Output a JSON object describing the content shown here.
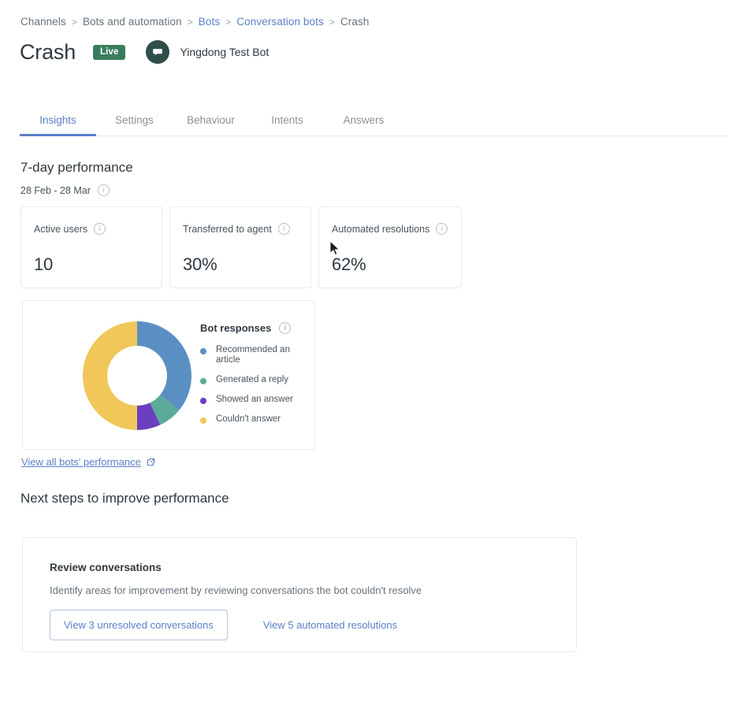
{
  "breadcrumb": {
    "items": [
      {
        "label": "Channels",
        "style": "plain"
      },
      {
        "label": "Bots and automation",
        "style": "plain"
      },
      {
        "label": "Bots",
        "style": "link"
      },
      {
        "label": "Conversation bots",
        "style": "link"
      },
      {
        "label": "Crash",
        "style": "plain"
      }
    ],
    "separator": ">"
  },
  "header": {
    "title": "Crash",
    "status_badge": "Live",
    "bot_name": "Yingdong Test Bot",
    "badge_color": "#3a7d5d",
    "avatar_color": "#2f4f4a"
  },
  "tabs": [
    {
      "label": "Insights",
      "active": true
    },
    {
      "label": "Settings",
      "active": false
    },
    {
      "label": "Behaviour",
      "active": false
    },
    {
      "label": "Intents",
      "active": false
    },
    {
      "label": "Answers",
      "active": false
    }
  ],
  "performance": {
    "title": "7-day performance",
    "date_range": "28 Feb - 28 Mar",
    "metrics": [
      {
        "label": "Active users",
        "value": "10"
      },
      {
        "label": "Transferred to agent",
        "value": "30%"
      },
      {
        "label": "Automated resolutions",
        "value": "62%"
      }
    ]
  },
  "chart_data": {
    "type": "pie",
    "title": "Bot responses",
    "categories": [
      "Recommended an article",
      "Generated a reply",
      "Showed an answer",
      "Couldn't answer"
    ],
    "values": [
      36,
      7,
      7,
      50
    ],
    "colors": [
      "#5b8fc4",
      "#5aab99",
      "#6b3fbf",
      "#f0c758"
    ],
    "legend_position": "right",
    "donut": true,
    "inner_radius_ratio": 0.55
  },
  "links": {
    "view_all": "View all bots' performance"
  },
  "next_steps": {
    "title": "Next steps to improve performance",
    "card": {
      "title": "Review conversations",
      "description": "Identify areas for improvement by reviewing conversations the bot couldn't resolve",
      "primary_button": "View 3 unresolved conversations",
      "secondary_button": "View 5 automated resolutions"
    }
  },
  "icons": {
    "info": "i"
  },
  "theme": {
    "accent": "#5b7fc7",
    "text": "#2f3941",
    "muted": "#68737d",
    "border": "#e9ebed"
  }
}
